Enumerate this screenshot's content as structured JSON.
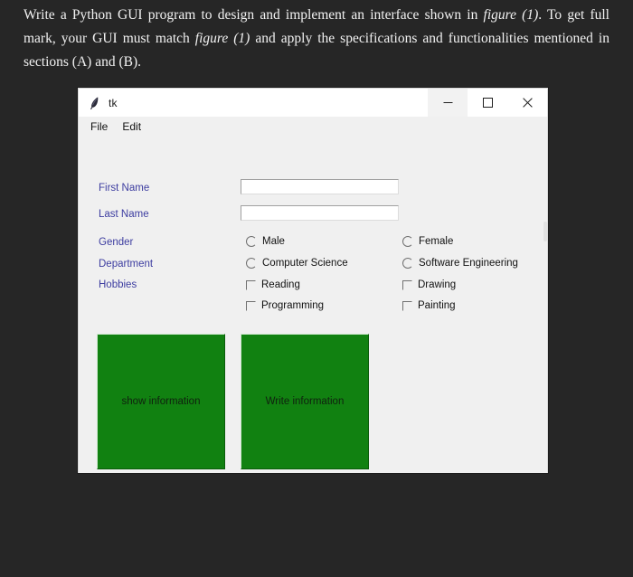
{
  "question": {
    "line1_a": "Write a Python GUI program to design and implement an interface shown in ",
    "line1_italic": "figure (1)",
    "line1_b": ". To get full mark, your GUI must match ",
    "line2_italic": "figure (1)",
    "line2_b": " and apply the specifications and functionalities mentioned in sections (A) and (B)."
  },
  "window": {
    "title": "tk",
    "icon": "feather-icon",
    "buttons": {
      "minimize": "–",
      "maximize": "□",
      "close": "✕"
    },
    "menu": [
      {
        "label": "File"
      },
      {
        "label": "Edit"
      }
    ],
    "colors": {
      "client_bg": "#f0f0f0",
      "titlebar_bg": "#ffffff",
      "label_fg": "#3d3da0",
      "button_bg": "#118111",
      "button_fg": "#10210f",
      "page_bg": "#262626"
    },
    "form": {
      "labels": [
        {
          "text": "First Name"
        },
        {
          "text": "Last Name"
        },
        {
          "text": "Gender"
        },
        {
          "text": "Department"
        },
        {
          "text": "Hobbies"
        }
      ],
      "entries": [
        {
          "name": "first-name",
          "value": "",
          "placeholder": ""
        },
        {
          "name": "last-name",
          "value": "",
          "placeholder": ""
        }
      ],
      "gender": [
        {
          "label": "Male",
          "checked": false
        },
        {
          "label": "Female",
          "checked": false
        }
      ],
      "department": [
        {
          "label": "Computer Science",
          "checked": false
        },
        {
          "label": "Software Engineering",
          "checked": false
        }
      ],
      "hobbies": [
        {
          "label": "Reading",
          "checked": false
        },
        {
          "label": "Drawing",
          "checked": false
        },
        {
          "label": "Programming",
          "checked": false
        },
        {
          "label": "Painting",
          "checked": false
        }
      ],
      "actions": [
        {
          "label": "show information"
        },
        {
          "label": "Write information"
        }
      ]
    }
  }
}
